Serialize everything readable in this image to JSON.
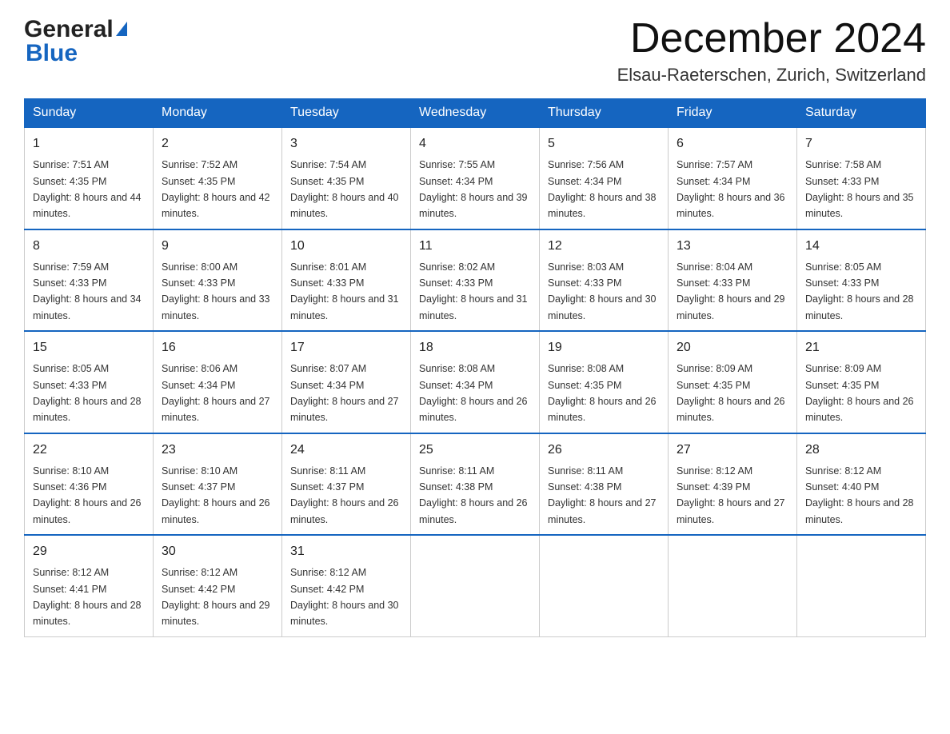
{
  "header": {
    "logo_text1": "General",
    "logo_text2": "Blue",
    "month_title": "December 2024",
    "location": "Elsau-Raeterschen, Zurich, Switzerland"
  },
  "days_of_week": [
    "Sunday",
    "Monday",
    "Tuesday",
    "Wednesday",
    "Thursday",
    "Friday",
    "Saturday"
  ],
  "weeks": [
    {
      "days": [
        {
          "number": "1",
          "sunrise": "Sunrise: 7:51 AM",
          "sunset": "Sunset: 4:35 PM",
          "daylight": "Daylight: 8 hours and 44 minutes."
        },
        {
          "number": "2",
          "sunrise": "Sunrise: 7:52 AM",
          "sunset": "Sunset: 4:35 PM",
          "daylight": "Daylight: 8 hours and 42 minutes."
        },
        {
          "number": "3",
          "sunrise": "Sunrise: 7:54 AM",
          "sunset": "Sunset: 4:35 PM",
          "daylight": "Daylight: 8 hours and 40 minutes."
        },
        {
          "number": "4",
          "sunrise": "Sunrise: 7:55 AM",
          "sunset": "Sunset: 4:34 PM",
          "daylight": "Daylight: 8 hours and 39 minutes."
        },
        {
          "number": "5",
          "sunrise": "Sunrise: 7:56 AM",
          "sunset": "Sunset: 4:34 PM",
          "daylight": "Daylight: 8 hours and 38 minutes."
        },
        {
          "number": "6",
          "sunrise": "Sunrise: 7:57 AM",
          "sunset": "Sunset: 4:34 PM",
          "daylight": "Daylight: 8 hours and 36 minutes."
        },
        {
          "number": "7",
          "sunrise": "Sunrise: 7:58 AM",
          "sunset": "Sunset: 4:33 PM",
          "daylight": "Daylight: 8 hours and 35 minutes."
        }
      ]
    },
    {
      "days": [
        {
          "number": "8",
          "sunrise": "Sunrise: 7:59 AM",
          "sunset": "Sunset: 4:33 PM",
          "daylight": "Daylight: 8 hours and 34 minutes."
        },
        {
          "number": "9",
          "sunrise": "Sunrise: 8:00 AM",
          "sunset": "Sunset: 4:33 PM",
          "daylight": "Daylight: 8 hours and 33 minutes."
        },
        {
          "number": "10",
          "sunrise": "Sunrise: 8:01 AM",
          "sunset": "Sunset: 4:33 PM",
          "daylight": "Daylight: 8 hours and 31 minutes."
        },
        {
          "number": "11",
          "sunrise": "Sunrise: 8:02 AM",
          "sunset": "Sunset: 4:33 PM",
          "daylight": "Daylight: 8 hours and 31 minutes."
        },
        {
          "number": "12",
          "sunrise": "Sunrise: 8:03 AM",
          "sunset": "Sunset: 4:33 PM",
          "daylight": "Daylight: 8 hours and 30 minutes."
        },
        {
          "number": "13",
          "sunrise": "Sunrise: 8:04 AM",
          "sunset": "Sunset: 4:33 PM",
          "daylight": "Daylight: 8 hours and 29 minutes."
        },
        {
          "number": "14",
          "sunrise": "Sunrise: 8:05 AM",
          "sunset": "Sunset: 4:33 PM",
          "daylight": "Daylight: 8 hours and 28 minutes."
        }
      ]
    },
    {
      "days": [
        {
          "number": "15",
          "sunrise": "Sunrise: 8:05 AM",
          "sunset": "Sunset: 4:33 PM",
          "daylight": "Daylight: 8 hours and 28 minutes."
        },
        {
          "number": "16",
          "sunrise": "Sunrise: 8:06 AM",
          "sunset": "Sunset: 4:34 PM",
          "daylight": "Daylight: 8 hours and 27 minutes."
        },
        {
          "number": "17",
          "sunrise": "Sunrise: 8:07 AM",
          "sunset": "Sunset: 4:34 PM",
          "daylight": "Daylight: 8 hours and 27 minutes."
        },
        {
          "number": "18",
          "sunrise": "Sunrise: 8:08 AM",
          "sunset": "Sunset: 4:34 PM",
          "daylight": "Daylight: 8 hours and 26 minutes."
        },
        {
          "number": "19",
          "sunrise": "Sunrise: 8:08 AM",
          "sunset": "Sunset: 4:35 PM",
          "daylight": "Daylight: 8 hours and 26 minutes."
        },
        {
          "number": "20",
          "sunrise": "Sunrise: 8:09 AM",
          "sunset": "Sunset: 4:35 PM",
          "daylight": "Daylight: 8 hours and 26 minutes."
        },
        {
          "number": "21",
          "sunrise": "Sunrise: 8:09 AM",
          "sunset": "Sunset: 4:35 PM",
          "daylight": "Daylight: 8 hours and 26 minutes."
        }
      ]
    },
    {
      "days": [
        {
          "number": "22",
          "sunrise": "Sunrise: 8:10 AM",
          "sunset": "Sunset: 4:36 PM",
          "daylight": "Daylight: 8 hours and 26 minutes."
        },
        {
          "number": "23",
          "sunrise": "Sunrise: 8:10 AM",
          "sunset": "Sunset: 4:37 PM",
          "daylight": "Daylight: 8 hours and 26 minutes."
        },
        {
          "number": "24",
          "sunrise": "Sunrise: 8:11 AM",
          "sunset": "Sunset: 4:37 PM",
          "daylight": "Daylight: 8 hours and 26 minutes."
        },
        {
          "number": "25",
          "sunrise": "Sunrise: 8:11 AM",
          "sunset": "Sunset: 4:38 PM",
          "daylight": "Daylight: 8 hours and 26 minutes."
        },
        {
          "number": "26",
          "sunrise": "Sunrise: 8:11 AM",
          "sunset": "Sunset: 4:38 PM",
          "daylight": "Daylight: 8 hours and 27 minutes."
        },
        {
          "number": "27",
          "sunrise": "Sunrise: 8:12 AM",
          "sunset": "Sunset: 4:39 PM",
          "daylight": "Daylight: 8 hours and 27 minutes."
        },
        {
          "number": "28",
          "sunrise": "Sunrise: 8:12 AM",
          "sunset": "Sunset: 4:40 PM",
          "daylight": "Daylight: 8 hours and 28 minutes."
        }
      ]
    },
    {
      "days": [
        {
          "number": "29",
          "sunrise": "Sunrise: 8:12 AM",
          "sunset": "Sunset: 4:41 PM",
          "daylight": "Daylight: 8 hours and 28 minutes."
        },
        {
          "number": "30",
          "sunrise": "Sunrise: 8:12 AM",
          "sunset": "Sunset: 4:42 PM",
          "daylight": "Daylight: 8 hours and 29 minutes."
        },
        {
          "number": "31",
          "sunrise": "Sunrise: 8:12 AM",
          "sunset": "Sunset: 4:42 PM",
          "daylight": "Daylight: 8 hours and 30 minutes."
        },
        null,
        null,
        null,
        null
      ]
    }
  ]
}
